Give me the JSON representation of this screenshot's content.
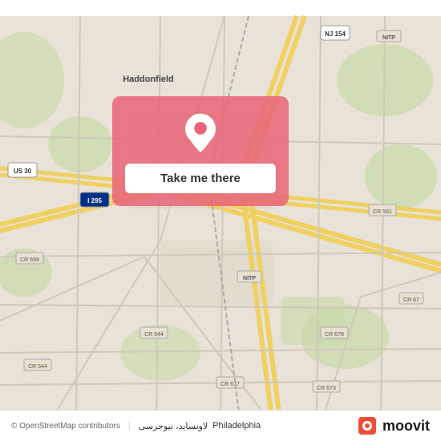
{
  "map": {
    "attribution": "© OpenStreetMap contributors",
    "city": "Philadelphia",
    "location_arabic": "لاونساید، نیوجرسی"
  },
  "card": {
    "button_label": "Take me there"
  },
  "moovit": {
    "logo_text": "moovit"
  },
  "road_labels": [
    {
      "id": "us30",
      "text": "US 30"
    },
    {
      "id": "i295",
      "text": "I 295"
    },
    {
      "id": "nj154",
      "text": "NJ 154"
    },
    {
      "id": "nitp1",
      "text": "NITP"
    },
    {
      "id": "nitp2",
      "text": "NITP"
    },
    {
      "id": "cr659",
      "text": "CR 659"
    },
    {
      "id": "cr561",
      "text": "CR 561"
    },
    {
      "id": "cr544a",
      "text": "CR 544"
    },
    {
      "id": "cr544b",
      "text": "CR 544"
    },
    {
      "id": "cr677",
      "text": "CR 677"
    },
    {
      "id": "cr678",
      "text": "CR 678"
    },
    {
      "id": "cr673",
      "text": "CR 673"
    },
    {
      "id": "cr67",
      "text": "CR 67"
    },
    {
      "id": "haddonfield",
      "text": "Haddonfield"
    }
  ]
}
